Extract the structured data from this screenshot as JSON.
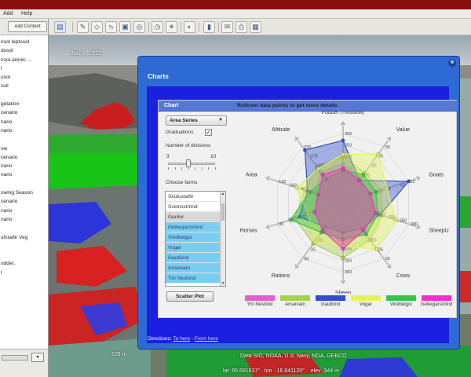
{
  "menu": {
    "items": [
      "Add",
      "Help"
    ]
  },
  "sidebar": {
    "add_content_label": "Add Content",
    "items": [
      "risol leptosol",
      "dosol",
      "risol-arenic ...",
      "l",
      "osol",
      "isol",
      "",
      "getation",
      "cenario",
      "nario",
      "nario",
      "",
      "ow",
      "cenario",
      "nario",
      "nario",
      "",
      "owing Season",
      "cenario",
      "nario",
      "nario",
      "",
      "ofstaðir Veg",
      "",
      "",
      "odder,",
      "l"
    ]
  },
  "map": {
    "time_label": "Jan  1, 1712",
    "scale_label": "109 m",
    "credit": "Data SIO, NOAA, U.S. Navy, NGA, GEBCO",
    "coords": "lat  65.591637°   lon  -16.841120°    elev  344 m"
  },
  "dialog": {
    "title": "Charts",
    "close_glyph": "⊗",
    "panel_title": "Chart",
    "footer_prefix": "Directions: ",
    "footer_to": "To here",
    "footer_sep": " - ",
    "footer_from": "From here",
    "series_select_value": "Area Series",
    "graduations_label": "Graduations",
    "graduations_checked": true,
    "divisions_label": "Number of divisions",
    "divisions_min": "3",
    "divisions_max": "10",
    "divisions_value": 6,
    "choose_farms_label": "Choose farms",
    "farms": [
      "Skútustaðir",
      "Sveinsströnd",
      "Garður",
      "Geiteyjarströnd",
      "Vindbelgur",
      "Vogar",
      "Gautlönd",
      "Arnarvatn",
      "Ytri Neslönd"
    ],
    "selected_farms": [
      "Geiteyjarströnd",
      "Vindbelgur",
      "Vogar",
      "Gautlönd",
      "Arnarvatn",
      "Ytri Neslönd"
    ],
    "hovered_farm": "Garður",
    "scatter_button_label": "Scatter Plot",
    "rollover_hint": "Rollover data points to get more details"
  },
  "colors": {
    "title_bar": "#8a1010",
    "dialog_blue": "#2d6ad3",
    "dialog_inner": "#1b1fe0",
    "farm_selected": "#79cdf0"
  },
  "chart_data": {
    "type": "radar",
    "axes": [
      {
        "label": "Fodder",
        "unit": "(Thousands)",
        "ticks": [
          "50",
          "100",
          "150",
          "200",
          "250",
          "300"
        ]
      },
      {
        "label": "Value",
        "ticks": [
          "5",
          "10",
          "15",
          "20",
          "25",
          "30"
        ]
      },
      {
        "label": "Goats",
        "ticks": [
          "2",
          "4",
          "6",
          "8",
          "10",
          "12"
        ]
      },
      {
        "label": "SheepU",
        "ticks": [
          "50",
          "100",
          "150",
          "200",
          "250",
          "300"
        ]
      },
      {
        "label": "Cows",
        "ticks": [
          "5",
          "10",
          "15",
          "20",
          "25",
          "30"
        ]
      },
      {
        "label": "Sheep",
        "ticks": [
          "50",
          "100",
          "150",
          "200",
          "250",
          "300"
        ]
      },
      {
        "label": "Rations",
        "ticks": [
          "5",
          "10",
          "15",
          "20",
          "25",
          "30"
        ]
      },
      {
        "label": "Horses",
        "ticks": [
          "5",
          "10",
          "15",
          "20",
          "25",
          "30"
        ]
      },
      {
        "label": "Area",
        "ticks": [
          "20",
          "40",
          "60",
          "80",
          "100",
          "120"
        ]
      },
      {
        "label": "Altitude",
        "ticks": [
          "55",
          "110",
          "165",
          "220",
          "275",
          "330"
        ]
      }
    ],
    "max": [
      300,
      30,
      12,
      300,
      30,
      300,
      30,
      30,
      120,
      330
    ],
    "series": [
      {
        "name": "Ytri Neslönd",
        "color": "#e060d0",
        "values": [
          170,
          13,
          5,
          140,
          16,
          180,
          14,
          12,
          50,
          180
        ]
      },
      {
        "name": "Arnarvatn",
        "color": "#a8d050",
        "values": [
          200,
          16,
          7,
          180,
          20,
          240,
          22,
          22,
          70,
          210
        ]
      },
      {
        "name": "Gautlönd",
        "color": "#2f4ec8",
        "values": [
          270,
          12,
          12,
          170,
          14,
          130,
          13,
          20,
          65,
          310
        ]
      },
      {
        "name": "Vogar",
        "color": "#e6f25a",
        "values": [
          210,
          26,
          8,
          240,
          25,
          190,
          21,
          16,
          85,
          200
        ]
      },
      {
        "name": "Vindbelgur",
        "color": "#39c24a",
        "values": [
          140,
          15,
          6,
          160,
          17,
          160,
          16,
          24,
          60,
          140
        ]
      },
      {
        "name": "Geiteyjarströnd",
        "color": "#f030c8",
        "values": [
          150,
          12,
          5,
          150,
          15,
          200,
          15,
          13,
          45,
          165
        ]
      }
    ],
    "divisions": 6,
    "grid": true,
    "legend": "bottom"
  }
}
